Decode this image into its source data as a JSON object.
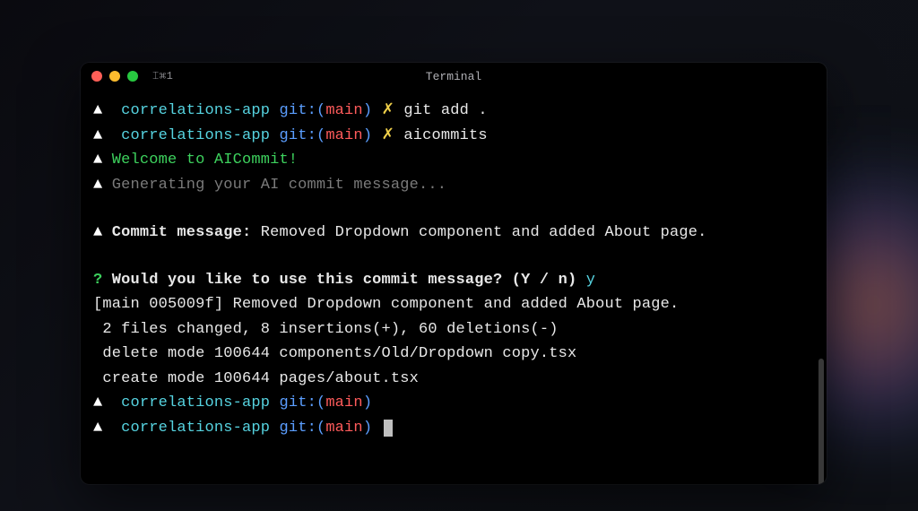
{
  "window": {
    "tab_label": "⌶⌘1",
    "title": "Terminal"
  },
  "colors": {
    "traffic_red": "#ff5f57",
    "traffic_yellow": "#febc2e",
    "traffic_green": "#28c840",
    "cyan": "#56d3e0",
    "blue": "#5b9eff",
    "red": "#ff5b5b",
    "yellow": "#f0d04a",
    "green": "#3dd15d",
    "grey": "#7a7a7a",
    "white": "#e8e8e8"
  },
  "prompt": {
    "triangle": "▲",
    "dir": "correlations-app",
    "git_label": "git:(",
    "branch": "main",
    "git_close": ")",
    "dirty": "✗"
  },
  "lines": {
    "cmd1": "git add .",
    "cmd2": "aicommits",
    "welcome": "Welcome to AICommit!",
    "generating": "Generating your AI commit message...",
    "commit_label": "Commit message:",
    "commit_msg": "Removed Dropdown component and added About page.",
    "confirm_q": "Would you like to use this commit message? (Y / n)",
    "confirm_a": "y",
    "result1": "[main 005009f] Removed Dropdown component and added About page.",
    "result2": " 2 files changed, 8 insertions(+), 60 deletions(-)",
    "result3": " delete mode 100644 components/Old/Dropdown copy.tsx",
    "result4": " create mode 100644 pages/about.tsx"
  }
}
